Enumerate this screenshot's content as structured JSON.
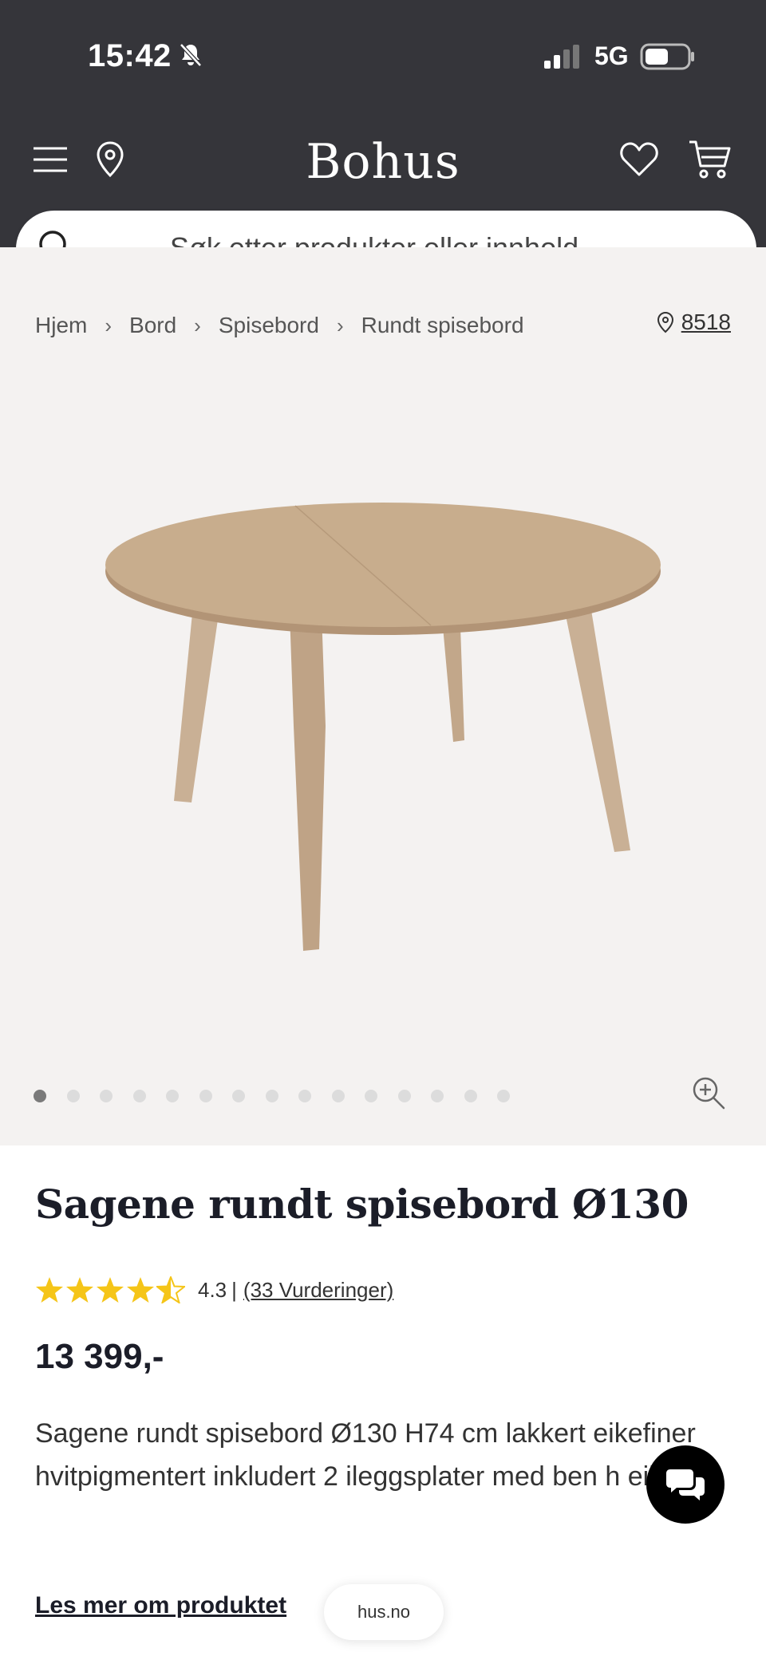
{
  "status_bar": {
    "time": "15:42",
    "network": "5G"
  },
  "header": {
    "logo": "Bohus"
  },
  "search": {
    "placeholder": "Søk etter produkter eller innhold..."
  },
  "breadcrumb": [
    "Hjem",
    "Bord",
    "Spisebord",
    "Rundt spisebord"
  ],
  "store": {
    "code": "8518"
  },
  "gallery": {
    "image_count": 15,
    "active_index": 0
  },
  "product": {
    "title": "Sagene rundt spisebord Ø130",
    "rating_value": 4.3,
    "rating_text": "4.3",
    "rating_count": "(33 Vurderinger)",
    "price": "13 399,-",
    "description": "Sagene rundt spisebord Ø130 H74 cm lakkert eikefiner hvitpigmentert inkludert 2 ileggsplater med ben h eik",
    "read_more": "Les mer om produktet"
  },
  "url_pill": "hus.no",
  "icons": {
    "menu": "hamburger-icon",
    "location": "map-pin-icon",
    "wishlist": "heart-icon",
    "cart": "cart-icon",
    "search": "search-icon",
    "zoom": "zoom-in-icon",
    "chat": "chat-icon",
    "silent": "bell-off-icon"
  },
  "colors": {
    "header_bg": "#35353a",
    "gallery_bg": "#f4f2f1",
    "star": "#f5c518",
    "title": "#1b1d28"
  }
}
